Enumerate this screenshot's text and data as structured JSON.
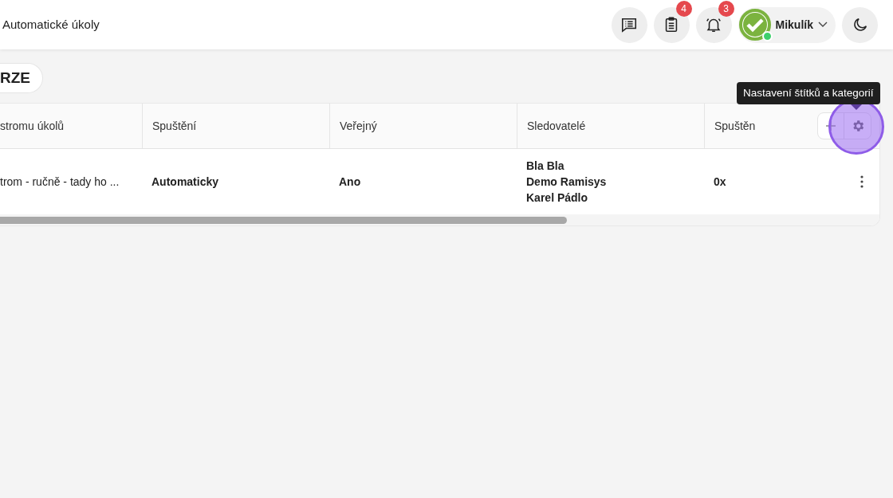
{
  "header": {
    "title": "Automatické úkoly",
    "icon_buttons": [
      {
        "kind": "messages"
      },
      {
        "kind": "tasks",
        "badge": "4"
      },
      {
        "kind": "notifications",
        "badge": "3"
      }
    ],
    "user": {
      "name": "Mikulík",
      "online": true
    },
    "theme_button": {
      "kind": "moon"
    }
  },
  "toolbar": {
    "button": "RZE"
  },
  "table": {
    "columns": [
      "stromu úkolů",
      "Spuštění",
      "Veřejný",
      "Sledovatelé",
      "Spuštěn"
    ],
    "rows": [
      {
        "cells": [
          "trom - ručně - tady ho ...",
          "Automaticky",
          "Ano"
        ],
        "followers": [
          "Bla Bla",
          "Demo Ramisys",
          "Karel Pádlo"
        ],
        "runs": "0x"
      }
    ]
  },
  "tooltip": {
    "text": "Nastavení štítků a kategorií"
  }
}
